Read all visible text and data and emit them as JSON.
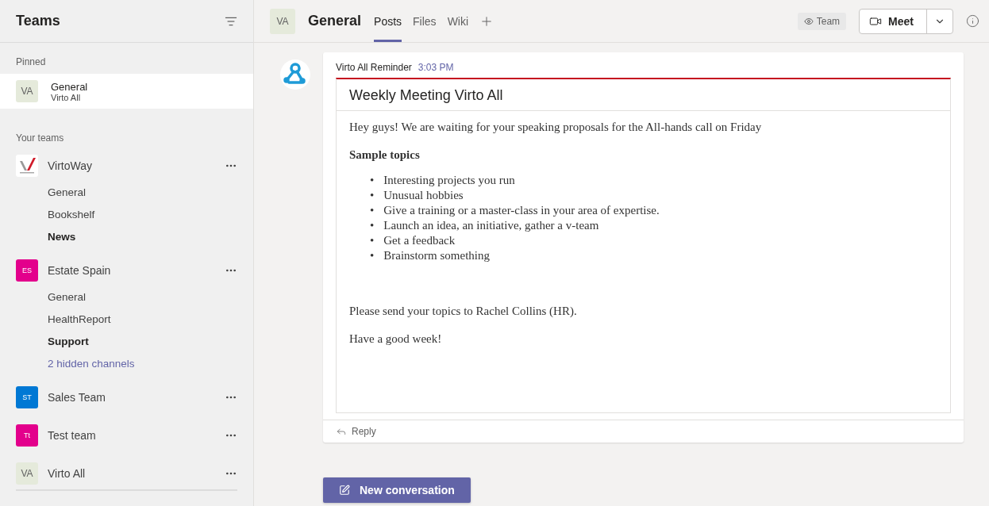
{
  "sidebar": {
    "title": "Teams",
    "pinned_label": "Pinned",
    "pinned": [
      {
        "avatar": "VA",
        "color": "#e5eadb",
        "name": "General",
        "team": "Virto All",
        "selected": true
      }
    ],
    "teams_label": "Your teams",
    "teams": [
      {
        "name": "VirtoWay",
        "channels": [
          {
            "name": "General",
            "unread": false,
            "kind": "channel"
          },
          {
            "name": "Bookshelf",
            "unread": false,
            "kind": "channel"
          },
          {
            "name": "News",
            "unread": true,
            "kind": "channel"
          }
        ]
      },
      {
        "name": "Estate Spain",
        "avatar": "ES",
        "color": "#e3008c",
        "channels": [
          {
            "name": "General",
            "unread": false,
            "kind": "channel"
          },
          {
            "name": "HealthReport",
            "unread": false,
            "kind": "channel"
          },
          {
            "name": "Support",
            "unread": true,
            "kind": "channel"
          },
          {
            "name": "2 hidden channels",
            "unread": false,
            "kind": "link"
          }
        ]
      },
      {
        "name": "Sales Team",
        "avatar": "ST",
        "color": "#0078d4"
      },
      {
        "name": "Test team",
        "avatar": "Tt",
        "color": "#e3008c"
      },
      {
        "name": "Virto All",
        "avatar": "VA",
        "color": "#e5eadb"
      }
    ]
  },
  "header": {
    "avatar": "VA",
    "channel": "General",
    "tabs": [
      {
        "label": "Posts",
        "selected": true
      },
      {
        "label": "Files",
        "selected": false
      },
      {
        "label": "Wiki",
        "selected": false
      }
    ],
    "team_badge": "Team",
    "meet": "Meet"
  },
  "post": {
    "author": "Virto All Reminder",
    "time": "3:03 PM",
    "card": {
      "title": "Weekly Meeting Virto All",
      "intro": "Hey guys! We are waiting for your speaking proposals for the All-hands call on Friday",
      "subtitle": "Sample topics",
      "bullet_marker": "•",
      "bullets": [
        "Interesting projects you run",
        "Unusual hobbies",
        "Give a training or a master-class in your area of expertise.",
        "Launch an idea, an initiative, gather a v-team",
        "Get a feedback",
        "Brainstorm something"
      ],
      "paragraphs": [
        "Please send your topics to Rachel Collins (HR).",
        "Have a good week!"
      ]
    },
    "reply": "Reply"
  },
  "new_conversation": "New conversation"
}
